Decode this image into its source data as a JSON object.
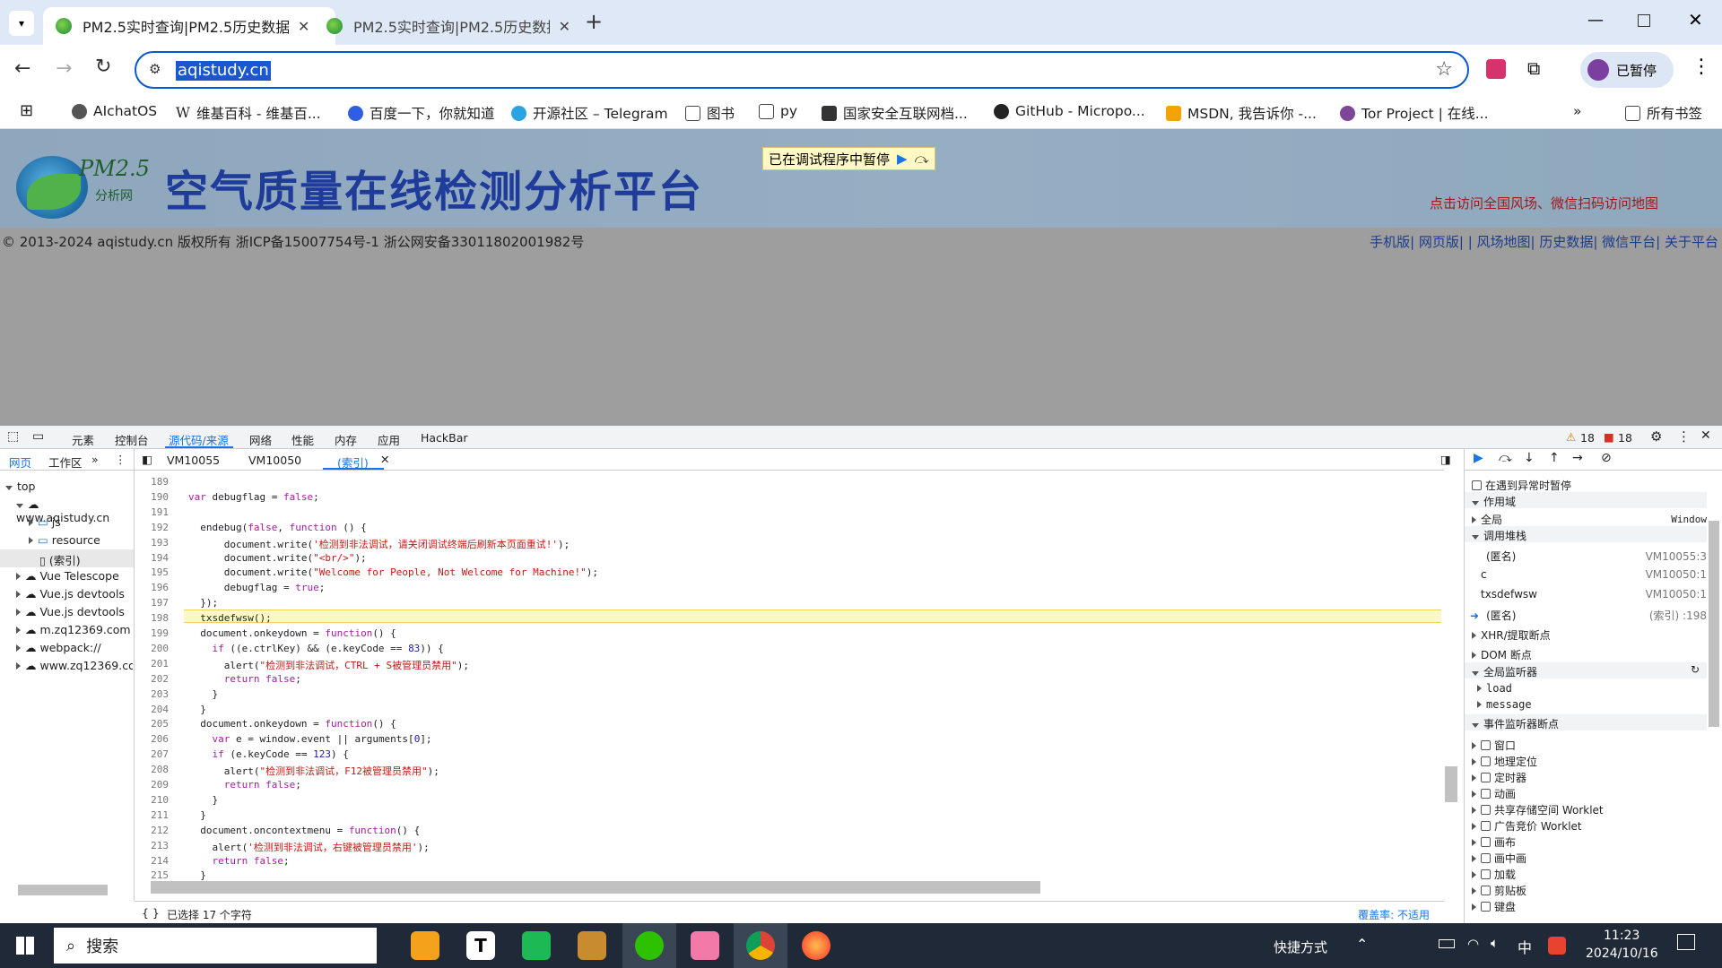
{
  "browser": {
    "tabs": [
      {
        "title": "PM2.5实时查询|PM2.5历史数据"
      },
      {
        "title": "PM2.5实时查询|PM2.5历史数据"
      }
    ],
    "url": "aqistudy.cn",
    "profile_label": "已暂停",
    "bookmarks": [
      "AIchatOS",
      "维基百科 - 维基百...",
      "百度一下，你就知道",
      "开源社区 – Telegram",
      "图书",
      "py",
      "国家安全互联网档...",
      "GitHub - Micropo...",
      "MSDN, 我告诉你 -...",
      "Tor Project | 在线..."
    ],
    "all_bookmarks": "所有书签"
  },
  "page": {
    "logo_text": "PM2.5",
    "logo_sub": "分析网",
    "site_title": "空气质量在线检测分析平台",
    "paused_banner": "已在调试程序中暂停",
    "red_text": "点击访问全国风场、微信扫码访问地图",
    "copyright": "© 2013-2024 aqistudy.cn 版权所有 浙ICP备15007754号-1 浙公网安备33011802001982号",
    "links": "手机版| 网页版| | 风场地图| 历史数据| 微信平台| 关于平台"
  },
  "devtools": {
    "tabs": [
      "元素",
      "控制台",
      "源代码/来源",
      "网络",
      "性能",
      "内存",
      "应用",
      "HackBar"
    ],
    "active_tab": "源代码/来源",
    "warn_count": "18",
    "err_count": "18",
    "nav_tabs": [
      "网页",
      "工作区"
    ],
    "tree": [
      {
        "label": "top"
      },
      {
        "label": "www.aqistudy.cn"
      },
      {
        "label": "js"
      },
      {
        "label": "resource"
      },
      {
        "label": "(索引)"
      },
      {
        "label": "Vue Telescope"
      },
      {
        "label": "Vue.js devtools"
      },
      {
        "label": "Vue.js devtools"
      },
      {
        "label": "m.zq12369.com"
      },
      {
        "label": "webpack://"
      },
      {
        "label": "www.zq12369.co"
      }
    ],
    "file_tabs": [
      "VM10055",
      "VM10050",
      "(索引)"
    ],
    "code_lines": [
      {
        "n": "189",
        "t": ""
      },
      {
        "n": "190",
        "t": "var debugflag = false;"
      },
      {
        "n": "191",
        "t": ""
      },
      {
        "n": "192",
        "t": "  endebug(false, function () {"
      },
      {
        "n": "193",
        "t": "      document.write('检测到非法调试，请关闭调试终端后刷新本页面重试!');"
      },
      {
        "n": "194",
        "t": "      document.write(\"<br/>\");"
      },
      {
        "n": "195",
        "t": "      document.write(\"Welcome for People, Not Welcome for Machine!\");"
      },
      {
        "n": "196",
        "t": "      debugflag = true;"
      },
      {
        "n": "197",
        "t": "  });"
      },
      {
        "n": "198",
        "t": "  txsdefwsw();"
      },
      {
        "n": "199",
        "t": "  document.onkeydown = function() {"
      },
      {
        "n": "200",
        "t": "    if ((e.ctrlKey) && (e.keyCode == 83)) {"
      },
      {
        "n": "201",
        "t": "      alert(\"检测到非法调试，CTRL + S被管理员禁用\");"
      },
      {
        "n": "202",
        "t": "      return false;"
      },
      {
        "n": "203",
        "t": "    }"
      },
      {
        "n": "204",
        "t": "  }"
      },
      {
        "n": "205",
        "t": "  document.onkeydown = function() {"
      },
      {
        "n": "206",
        "t": "    var e = window.event || arguments[0];"
      },
      {
        "n": "207",
        "t": "    if (e.keyCode == 123) {"
      },
      {
        "n": "208",
        "t": "      alert(\"检测到非法调试，F12被管理员禁用\");"
      },
      {
        "n": "209",
        "t": "      return false;"
      },
      {
        "n": "210",
        "t": "    }"
      },
      {
        "n": "211",
        "t": "  }"
      },
      {
        "n": "212",
        "t": "  document.oncontextmenu = function() {"
      },
      {
        "n": "213",
        "t": "    alert('检测到非法调试，右键被管理员禁用');"
      },
      {
        "n": "214",
        "t": "    return false;"
      },
      {
        "n": "215",
        "t": "  }"
      }
    ],
    "status_left": "已选择 17 个字符",
    "status_right": "覆盖率: 不适用",
    "right_panel": {
      "pause_exceptions": "在遇到异常时暂停",
      "scope": "作用域",
      "global": "全局",
      "global_val": "Window",
      "call_stack": "调用堆栈",
      "stack": [
        {
          "fn": "(匿名)",
          "loc": "VM10055:3"
        },
        {
          "fn": "c",
          "loc": "VM10050:1"
        },
        {
          "fn": "txsdefwsw",
          "loc": "VM10050:1"
        },
        {
          "fn": "(匿名)",
          "loc": "(索引) :198"
        }
      ],
      "xhr": "XHR/提取断点",
      "dom": "DOM 断点",
      "global_listeners": "全局监听器",
      "listeners": [
        "load",
        "message"
      ],
      "event_bp": "事件监听器断点",
      "events": [
        "窗口",
        "地理定位",
        "定时器",
        "动画",
        "共享存储空间 Worklet",
        "广告竞价 Worklet",
        "画布",
        "画中画",
        "加载",
        "剪贴板",
        "键盘"
      ]
    }
  },
  "taskbar": {
    "search": "搜索",
    "shortcut": "快捷方式",
    "ime": "中",
    "time": "11:23",
    "date": "2024/10/16"
  }
}
